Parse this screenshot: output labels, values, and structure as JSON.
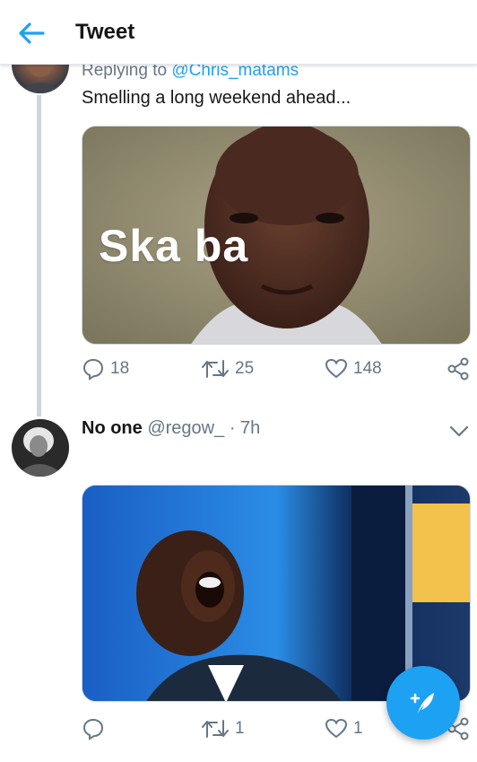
{
  "header": {
    "title": "Tweet",
    "back_icon": "arrow-left-icon"
  },
  "colors": {
    "accent": "#1da1f2",
    "secondary_text": "#657786",
    "primary_text": "#14171a",
    "thread_line": "#ccd6dd"
  },
  "tweet1": {
    "replying_prefix": "Replying to",
    "replying_handle": "@Chris_matams",
    "text": "Smelling a long weekend ahead...",
    "media_caption": "Ska ba",
    "reply_count": "18",
    "retweet_count": "25",
    "like_count": "148"
  },
  "tweet2": {
    "name": "No one",
    "handle": "@regow_",
    "separator": "·",
    "time": "7h",
    "reply_count": "",
    "retweet_count": "1",
    "like_count": "1"
  },
  "icons": {
    "reply": "comment-icon",
    "retweet": "retweet-icon",
    "like": "heart-icon",
    "share": "share-icon",
    "more": "chevron-down-icon",
    "compose": "compose-tweet-icon"
  }
}
